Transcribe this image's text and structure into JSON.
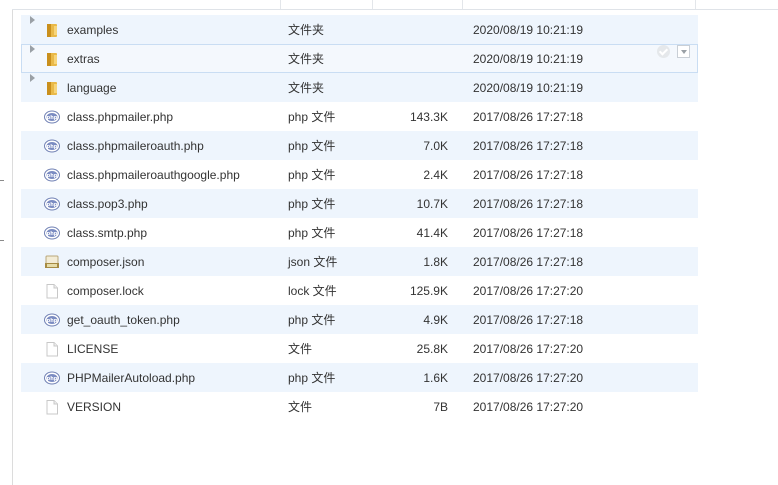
{
  "files": [
    {
      "name": "examples",
      "type": "文件夹",
      "size": "",
      "date": "2020/08/19 10:21:19",
      "kind": "folder"
    },
    {
      "name": "extras",
      "type": "文件夹",
      "size": "",
      "date": "2020/08/19 10:21:19",
      "kind": "folder"
    },
    {
      "name": "language",
      "type": "文件夹",
      "size": "",
      "date": "2020/08/19 10:21:19",
      "kind": "folder"
    },
    {
      "name": "class.phpmailer.php",
      "type": "php 文件",
      "size": "143.3K",
      "date": "2017/08/26 17:27:18",
      "kind": "php"
    },
    {
      "name": "class.phpmaileroauth.php",
      "type": "php 文件",
      "size": "7.0K",
      "date": "2017/08/26 17:27:18",
      "kind": "php"
    },
    {
      "name": "class.phpmaileroauthgoogle.php",
      "type": "php 文件",
      "size": "2.4K",
      "date": "2017/08/26 17:27:18",
      "kind": "php"
    },
    {
      "name": "class.pop3.php",
      "type": "php 文件",
      "size": "10.7K",
      "date": "2017/08/26 17:27:18",
      "kind": "php"
    },
    {
      "name": "class.smtp.php",
      "type": "php 文件",
      "size": "41.4K",
      "date": "2017/08/26 17:27:18",
      "kind": "php"
    },
    {
      "name": "composer.json",
      "type": "json 文件",
      "size": "1.8K",
      "date": "2017/08/26 17:27:18",
      "kind": "json"
    },
    {
      "name": "composer.lock",
      "type": "lock 文件",
      "size": "125.9K",
      "date": "2017/08/26 17:27:20",
      "kind": "file"
    },
    {
      "name": "get_oauth_token.php",
      "type": "php 文件",
      "size": "4.9K",
      "date": "2017/08/26 17:27:18",
      "kind": "php"
    },
    {
      "name": "LICENSE",
      "type": "文件",
      "size": "25.8K",
      "date": "2017/08/26 17:27:20",
      "kind": "file"
    },
    {
      "name": "PHPMailerAutoload.php",
      "type": "php 文件",
      "size": "1.6K",
      "date": "2017/08/26 17:27:20",
      "kind": "php"
    },
    {
      "name": "VERSION",
      "type": "文件",
      "size": "7B",
      "date": "2017/08/26 17:27:20",
      "kind": "file"
    }
  ],
  "hovered_row": "extras",
  "icons": {
    "folder": "folder-icon",
    "php": "php-file-icon",
    "json": "json-file-icon",
    "file": "file-icon",
    "expand": "expand-arrow-icon",
    "check": "check-icon",
    "menu": "dropdown-icon"
  }
}
